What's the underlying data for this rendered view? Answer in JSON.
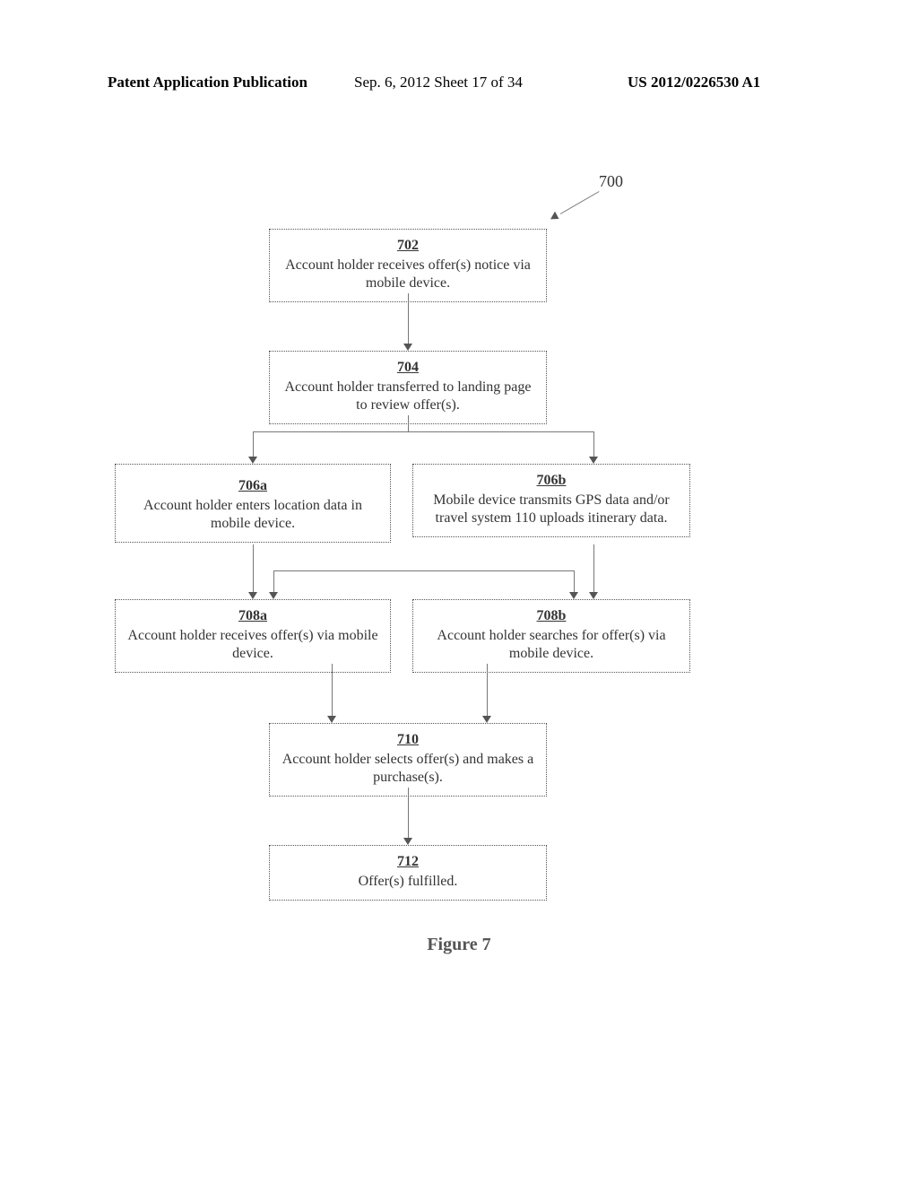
{
  "header": {
    "left": "Patent Application Publication",
    "center": "Sep. 6, 2012  Sheet 17 of 34",
    "right": "US 2012/0226530 A1"
  },
  "callout": {
    "num": "700"
  },
  "boxes": {
    "b702": {
      "ref": "702",
      "text": "Account holder receives offer(s) notice via mobile device."
    },
    "b704": {
      "ref": "704",
      "text": "Account holder transferred to landing page to review offer(s)."
    },
    "b706a": {
      "ref": "706a",
      "text": "Account holder enters location data in mobile device."
    },
    "b706b": {
      "ref": "706b",
      "text": "Mobile device transmits GPS data and/or travel system 110 uploads itinerary data."
    },
    "b708a": {
      "ref": "708a",
      "text": "Account holder receives offer(s) via mobile device."
    },
    "b708b": {
      "ref": "708b",
      "text": "Account holder searches for offer(s) via mobile device."
    },
    "b710": {
      "ref": "710",
      "text": "Account holder selects offer(s) and makes a purchase(s)."
    },
    "b712": {
      "ref": "712",
      "text": "Offer(s) fulfilled."
    }
  },
  "figure_label": "Figure 7",
  "chart_data": {
    "type": "flowchart",
    "title": "Figure 7",
    "callout": "700",
    "nodes": [
      {
        "id": "702",
        "label": "Account holder receives offer(s) notice via mobile device."
      },
      {
        "id": "704",
        "label": "Account holder transferred to landing page to review offer(s)."
      },
      {
        "id": "706a",
        "label": "Account holder enters location data in mobile device."
      },
      {
        "id": "706b",
        "label": "Mobile device transmits GPS data and/or travel system 110 uploads itinerary data."
      },
      {
        "id": "708a",
        "label": "Account holder receives offer(s) via mobile device."
      },
      {
        "id": "708b",
        "label": "Account holder searches for offer(s) via mobile device."
      },
      {
        "id": "710",
        "label": "Account holder selects offer(s) and makes a purchase(s)."
      },
      {
        "id": "712",
        "label": "Offer(s) fulfilled."
      }
    ],
    "edges": [
      {
        "from": "702",
        "to": "704"
      },
      {
        "from": "704",
        "to": "706a"
      },
      {
        "from": "704",
        "to": "706b"
      },
      {
        "from": "706a",
        "to": "708a"
      },
      {
        "from": "706a",
        "to": "708b"
      },
      {
        "from": "706b",
        "to": "708a"
      },
      {
        "from": "706b",
        "to": "708b"
      },
      {
        "from": "708a",
        "to": "710"
      },
      {
        "from": "708b",
        "to": "710"
      },
      {
        "from": "710",
        "to": "712"
      }
    ]
  }
}
